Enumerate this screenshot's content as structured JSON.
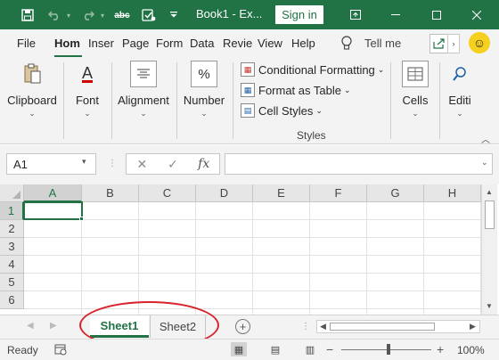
{
  "titlebar": {
    "title": "Book1 - Ex...",
    "signin_label": "Sign in",
    "color": "#217346"
  },
  "tabs": [
    {
      "label": "File"
    },
    {
      "label": "Hom",
      "active": true
    },
    {
      "label": "Inser"
    },
    {
      "label": "Page"
    },
    {
      "label": "Form"
    },
    {
      "label": "Data"
    },
    {
      "label": "Revie"
    },
    {
      "label": "View"
    },
    {
      "label": "Help"
    }
  ],
  "tellme": "Tell me",
  "ribbon": {
    "clipboard": "Clipboard",
    "font": "Font",
    "font_icon": "A",
    "alignment": "Alignment",
    "number": "Number",
    "number_icon": "%",
    "conditional_formatting": "Conditional Formatting",
    "format_as_table": "Format as Table",
    "cell_styles": "Cell Styles",
    "styles_group": "Styles",
    "cells": "Cells",
    "editing": "Editi"
  },
  "formula_bar": {
    "name_box": "A1",
    "cancel_icon": "✕",
    "enter_icon": "✓",
    "fx_icon": "fx",
    "formula_value": ""
  },
  "grid": {
    "columns": [
      "A",
      "B",
      "C",
      "D",
      "E",
      "F",
      "G",
      "H"
    ],
    "rows": [
      "1",
      "2",
      "3",
      "4",
      "5",
      "6"
    ],
    "active_cell": "A1"
  },
  "sheets": [
    {
      "name": "Sheet1",
      "active": true
    },
    {
      "name": "Sheet2",
      "active": false
    }
  ],
  "status": {
    "text": "Ready",
    "zoom": "100%",
    "zoom_minus": "−",
    "zoom_plus": "+"
  }
}
